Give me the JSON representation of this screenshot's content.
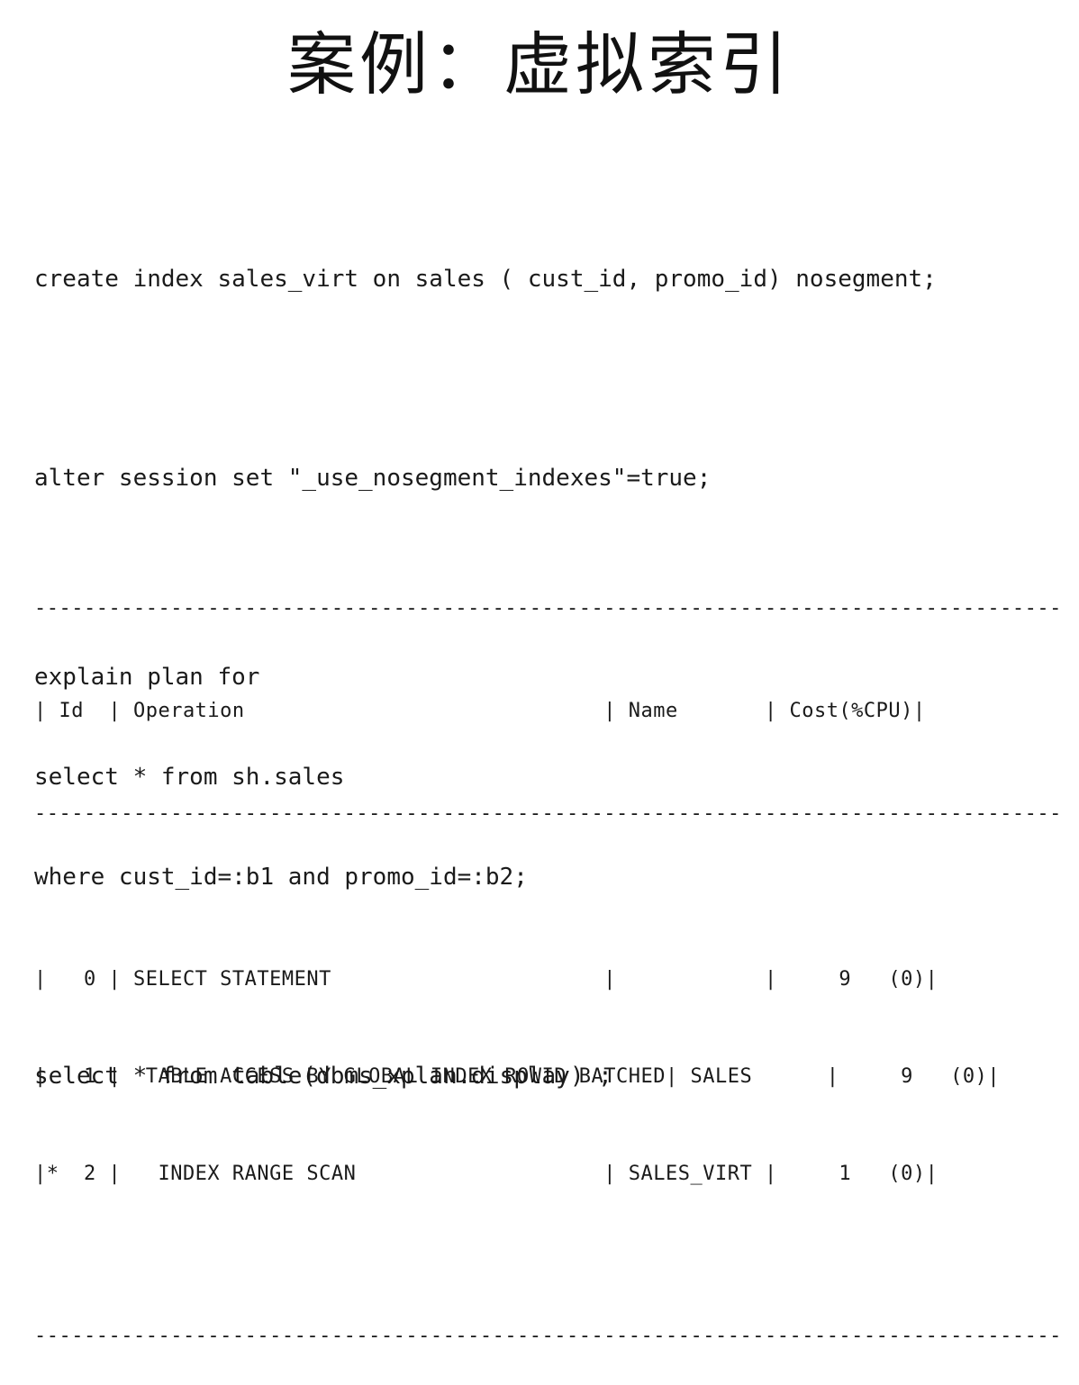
{
  "title": "案例：虚拟索引",
  "code_lines": [
    "create index sales_virt on sales ( cust_id, promo_id) nosegment;",
    "",
    "alter session set \"_use_nosegment_indexes\"=true;",
    "",
    "explain plan for",
    "select * from sh.sales",
    "where cust_id=:b1 and promo_id=:b2;",
    "",
    "select * from table(dbms_xplan.display) ;"
  ],
  "plan": {
    "rule": "-----------------------------------------------------------------------------------",
    "header": "| Id  | Operation                             | Name       | Cost(%CPU)|",
    "rows": [
      "|   0 | SELECT STATEMENT                      |            |     9   (0)|",
      "|   1 |  TABLE ACCESS BY GLOBAL INDEX ROWID BATCHED| SALES      |     9   (0)|",
      "|*  2 |   INDEX RANGE SCAN                    | SALES_VIRT |     1   (0)|"
    ]
  }
}
